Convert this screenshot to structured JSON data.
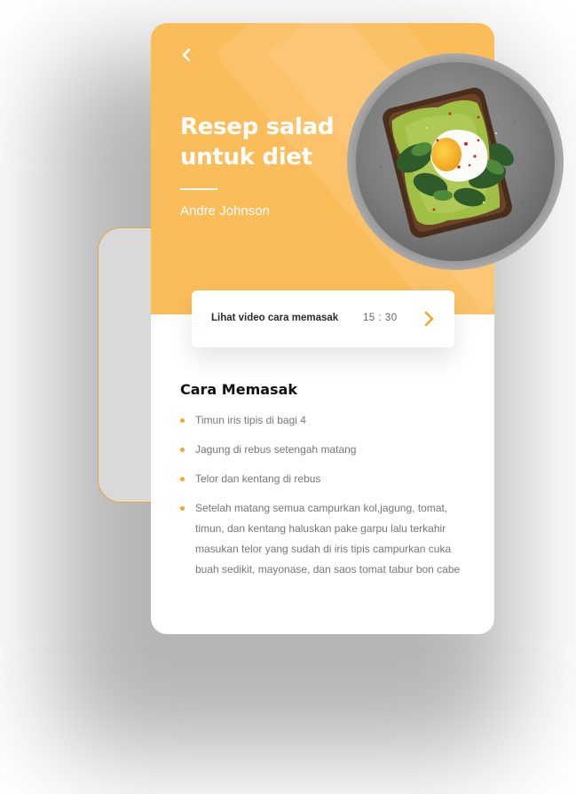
{
  "recipe": {
    "title": "Resep salad untuk diet",
    "author": "Andre Johnson"
  },
  "video": {
    "label": "Lihat video cara memasak",
    "duration": "15 : 30"
  },
  "instructions": {
    "heading": "Cara Memasak",
    "steps": [
      "Timun iris tipis di bagi 4",
      "Jagung di rebus setengah matang",
      "Telor dan kentang di rebus",
      "Setelah matang semua campurkan kol,jagung, tomat, timun, dan kentang haluskan pake garpu lalu terkahir masukan telor yang sudah di iris tipis campurkan cuka buah sedikit, mayonase, dan saos tomat tabur bon cabe"
    ]
  },
  "icons": {
    "back": "chevron-left-icon",
    "play": "chevron-right-icon",
    "bullet": "dot-icon"
  },
  "colors": {
    "accent": "#fbbc5a",
    "bullet": "#f5a623",
    "back_card_border": "#e8a43a",
    "heading": "#111111",
    "body_text": "#777777"
  }
}
